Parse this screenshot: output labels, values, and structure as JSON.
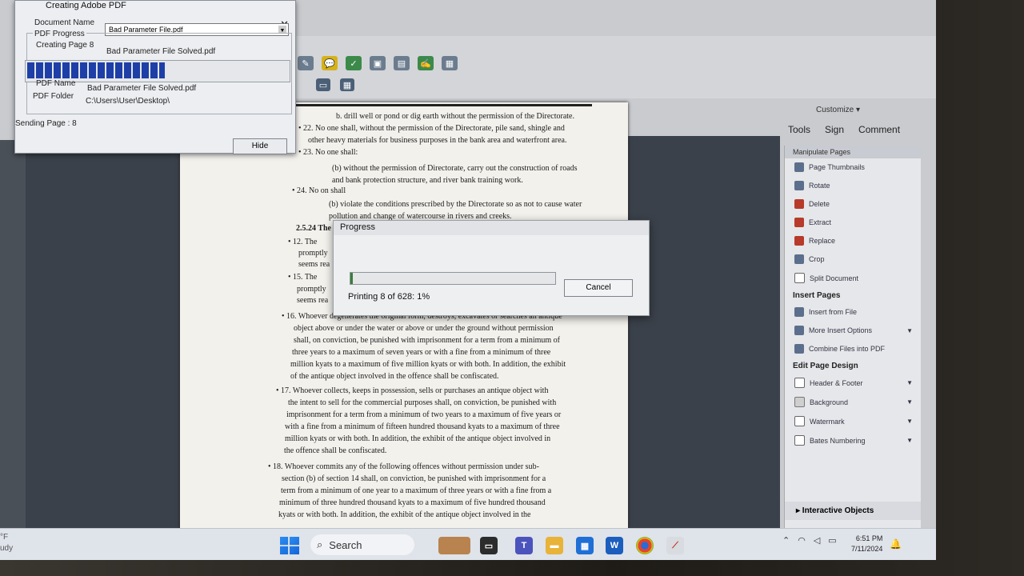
{
  "creating_window": {
    "title": "Creating Adobe PDF",
    "document_name_label": "Document Name",
    "document_name_value": "Bad Parameter File.pdf",
    "pdf_progress_label": "PDF Progress",
    "creating_page_label": "Creating Page 8",
    "creating_page_value": "Bad Parameter File Solved.pdf",
    "pdf_name_label": "PDF Name",
    "pdf_name_value": "Bad Parameter File Solved.pdf",
    "pdf_folder_label": "PDF Folder",
    "pdf_folder_value": "C:\\Users\\User\\Desktop\\",
    "sending_page": "Sending Page : 8",
    "hide_label": "Hide",
    "progress_fraction": 0.52
  },
  "progress_dialog": {
    "title": "Progress",
    "cancel_label": "Cancel",
    "status": "Printing 8 of 628: 1%",
    "progress_fraction": 0.01
  },
  "toolbar": {
    "customize": "Customize ▾",
    "tabs": [
      "Tools",
      "Sign",
      "Comment"
    ]
  },
  "tools_panel": {
    "manipulate_header": "Manipulate Pages",
    "manipulate_items": [
      "Page Thumbnails",
      "Rotate",
      "Delete",
      "Extract",
      "Replace",
      "Crop",
      "Split Document"
    ],
    "insert_header": "Insert Pages",
    "insert_items": [
      "Insert from File",
      "More Insert Options",
      "Combine Files into PDF"
    ],
    "edit_header": "Edit Page Design",
    "edit_items": [
      "Header & Footer",
      "Background",
      "Watermark",
      "Bates Numbering"
    ],
    "interactive": "▸ Interactive Objects"
  },
  "document": {
    "lines": [
      "b.   drill well or pond or dig earth without the permission of the Directorate.",
      "• 22. No one shall, without the permission of the Directorate, pile sand, shingle and",
      "other heavy materials for business purposes in the bank area and waterfront area.",
      "• 23. No one shall:",
      "(b)  without the permission of Directorate, carry out the construction of roads",
      "and bank protection structure, and river bank training work.",
      "• 24. No on shall",
      "(b) violate the conditions prescribed by the Directorate so as not to cause water",
      "pollution and change of watercourse in rivers and creeks.",
      "2.5.24 The",
      "• 12. The",
      "promptly",
      "seems rea",
      "• 15. The",
      "promptly",
      "seems rea",
      "• 16. Whoever degenerates the original form, destroys, excavates or searches an antique",
      "object above or under the water or above or under the ground without permission",
      "shall, on conviction, be punished with imprisonment for a term from a minimum of",
      "three years to a maximum of seven years or with a fine from a minimum of three",
      "million kyats to a maximum of five million kyats or with both. In addition, the exhibit",
      "of the antique object involved in the offence shall be confiscated.",
      "• 17. Whoever collects, keeps in possession, sells or purchases an antique object with",
      "the intent to sell for the commercial purposes shall, on conviction, be punished with",
      "imprisonment for a term from a minimum of two years to a maximum of five years or",
      "with a fine from a minimum of fifteen hundred thousand kyats to a maximum of three",
      "million kyats or with both. In addition, the exhibit of the antique object involved in",
      "the offence shall be confiscated.",
      "• 18. Whoever commits any of the following offences without permission under sub-",
      "section (b) of section 14 shall, on conviction, be punished with imprisonment for a",
      "term from a minimum of one year to a maximum of three years or with a fine from a",
      "minimum of three hundred thousand kyats to a maximum of five hundred thousand",
      "kyats or with both. In addition, the exhibit of the antique object involved in the"
    ]
  },
  "taskbar": {
    "weather_temp": "°F",
    "weather_desc": "udy",
    "search_label": "Search",
    "apps": [
      "widgets",
      "file-explorer",
      "teams",
      "folder",
      "store",
      "word",
      "chrome",
      "acrobat"
    ],
    "time": "6:51 PM",
    "date": "7/11/2024"
  }
}
